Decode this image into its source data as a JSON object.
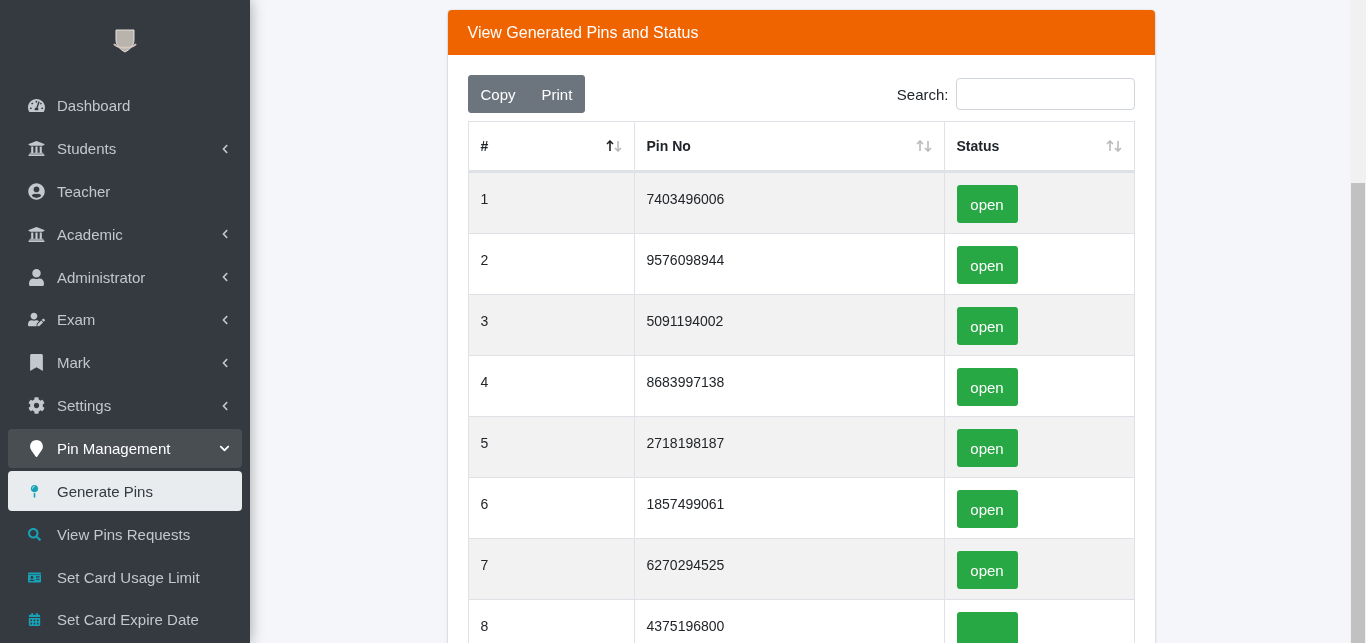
{
  "sidebar": {
    "items": [
      {
        "label": "Dashboard",
        "submenu": false,
        "expanded": false
      },
      {
        "label": "Students",
        "submenu": true,
        "expanded": false
      },
      {
        "label": "Teacher",
        "submenu": false,
        "expanded": false
      },
      {
        "label": "Academic",
        "submenu": true,
        "expanded": false
      },
      {
        "label": "Administrator",
        "submenu": true,
        "expanded": false
      },
      {
        "label": "Exam",
        "submenu": true,
        "expanded": false
      },
      {
        "label": "Mark",
        "submenu": true,
        "expanded": false
      },
      {
        "label": "Settings",
        "submenu": true,
        "expanded": false
      },
      {
        "label": "Pin Management",
        "submenu": true,
        "expanded": true,
        "children": [
          {
            "label": "Generate Pins",
            "selected": true
          },
          {
            "label": "View Pins Requests",
            "selected": false
          },
          {
            "label": "Set Card Usage Limit",
            "selected": false
          },
          {
            "label": "Set Card Expire Date",
            "selected": false
          }
        ]
      }
    ]
  },
  "card": {
    "title": "View Generated Pins and Status",
    "buttons": [
      "Copy",
      "Print"
    ],
    "search": {
      "label": "Search:"
    },
    "table": {
      "columns": [
        {
          "label": "#",
          "sorted": true
        },
        {
          "label": "Pin No",
          "sorted": false
        },
        {
          "label": "Status",
          "sorted": false
        }
      ],
      "rows": [
        {
          "number": "1",
          "pin": "7403496006",
          "status": "open"
        },
        {
          "number": "2",
          "pin": "9576098944",
          "status": "open"
        },
        {
          "number": "3",
          "pin": "5091194002",
          "status": "open"
        },
        {
          "number": "4",
          "pin": "8683997138",
          "status": "open"
        },
        {
          "number": "5",
          "pin": "2718198187",
          "status": "open"
        },
        {
          "number": "6",
          "pin": "1857499061",
          "status": "open"
        },
        {
          "number": "7",
          "pin": "6270294525",
          "status": "open"
        },
        {
          "number": "8",
          "pin": "4375196800"
        }
      ]
    }
  }
}
